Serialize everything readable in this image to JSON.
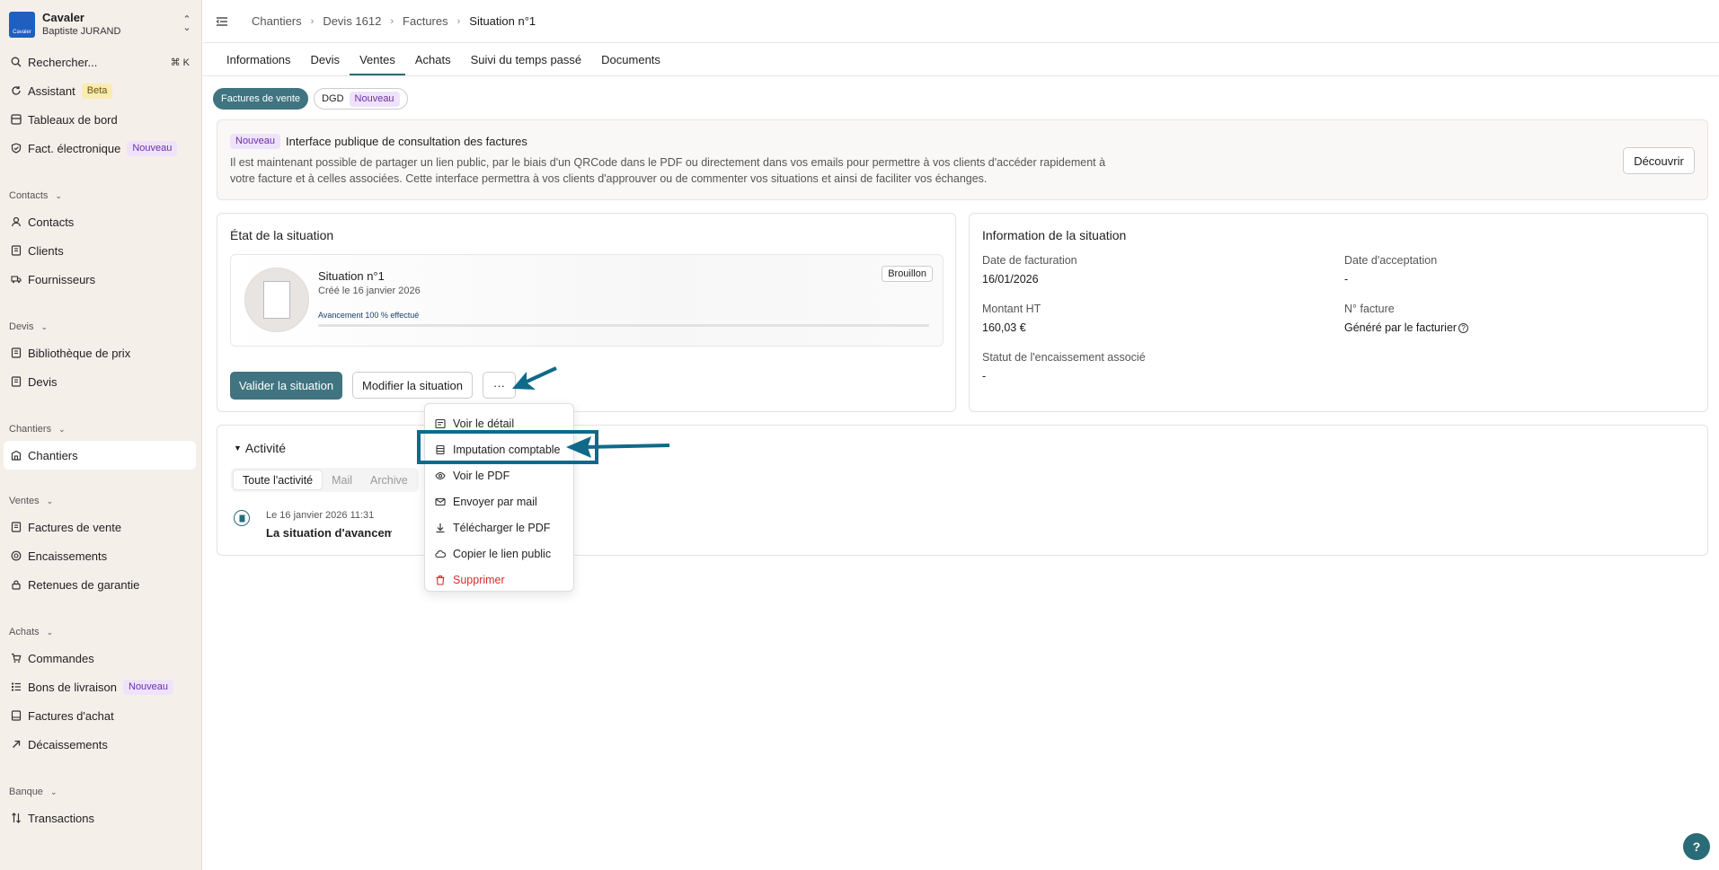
{
  "org": {
    "name": "Cavaler",
    "user": "Baptiste JURAND",
    "logo_text": "Cavaler"
  },
  "sidebar": {
    "search": {
      "label": "Rechercher...",
      "shortcut": "⌘ K"
    },
    "assistant": {
      "label": "Assistant",
      "badge": "Beta"
    },
    "dashboards": {
      "label": "Tableaux de bord"
    },
    "einvoice": {
      "label": "Fact. électronique",
      "badge": "Nouveau"
    },
    "contacts_section": "Contacts",
    "contacts": "Contacts",
    "clients": "Clients",
    "suppliers": "Fournisseurs",
    "devis_section": "Devis",
    "price_library": "Bibliothèque de prix",
    "devis": "Devis",
    "chantiers_section": "Chantiers",
    "chantiers": "Chantiers",
    "ventes_section": "Ventes",
    "sales_invoices": "Factures de vente",
    "encaissements": "Encaissements",
    "retenues": "Retenues de garantie",
    "achats_section": "Achats",
    "commandes": "Commandes",
    "bons_livraison": {
      "label": "Bons de livraison",
      "badge": "Nouveau"
    },
    "purchase_invoices": "Factures d'achat",
    "decaissements": "Décaissements",
    "banque_section": "Banque",
    "transactions": "Transactions"
  },
  "breadcrumb": [
    "Chantiers",
    "Devis 1612",
    "Factures",
    "Situation n°1"
  ],
  "tabs": [
    "Informations",
    "Devis",
    "Ventes",
    "Achats",
    "Suivi du temps passé",
    "Documents"
  ],
  "pills": {
    "sales": "Factures de vente",
    "dgd": "DGD",
    "dgd_badge": "Nouveau"
  },
  "banner": {
    "badge": "Nouveau",
    "title": "Interface publique de consultation des factures",
    "text": "Il est maintenant possible de partager un lien public, par le biais d'un QRCode dans le PDF ou directement dans vos emails pour permettre à vos clients d'accéder rapidement à votre facture et à celles associées. Cette interface permettra à vos clients d'approuver ou de commenter vos situations et ainsi de faciliter vos échanges.",
    "button": "Découvrir"
  },
  "state_card": {
    "title": "État de la situation",
    "situation_name": "Situation n°1",
    "created": "Créé le 16 janvier 2026",
    "status": "Brouillon",
    "progress_label": "Avancement 100 % effectué",
    "progress": 1.0,
    "validate_button": "Valider la situation",
    "edit_button": "Modifier la situation",
    "more_button": "···"
  },
  "info_card": {
    "title": "Information de la situation",
    "billing_date_label": "Date de facturation",
    "billing_date": "16/01/2026",
    "acceptance_date_label": "Date d'acceptation",
    "acceptance_date": "-",
    "amount_label": "Montant HT",
    "amount": "160,03 €",
    "invoice_number_label": "N° facture",
    "invoice_number": "Généré par le facturier",
    "payment_status_label": "Statut de l'encaissement associé",
    "payment_status": "-"
  },
  "activity": {
    "title": "Activité",
    "filters": [
      "Toute l'activité",
      "Mail",
      "Archive"
    ],
    "entry_date": "Le 16 janvier 2026 11:31",
    "entry_text": "La situation d'avancement a été"
  },
  "menu": {
    "items": [
      "Voir le détail",
      "Imputation comptable",
      "Voir le PDF",
      "Envoyer par mail",
      "Télécharger le PDF",
      "Copier le lien public",
      "Supprimer"
    ]
  },
  "help_fab": "?",
  "colors": {
    "primary": "#3f7480",
    "accent": "#0f6a8a",
    "danger": "#d92d2d",
    "sidebar_bg": "#f5efea"
  }
}
